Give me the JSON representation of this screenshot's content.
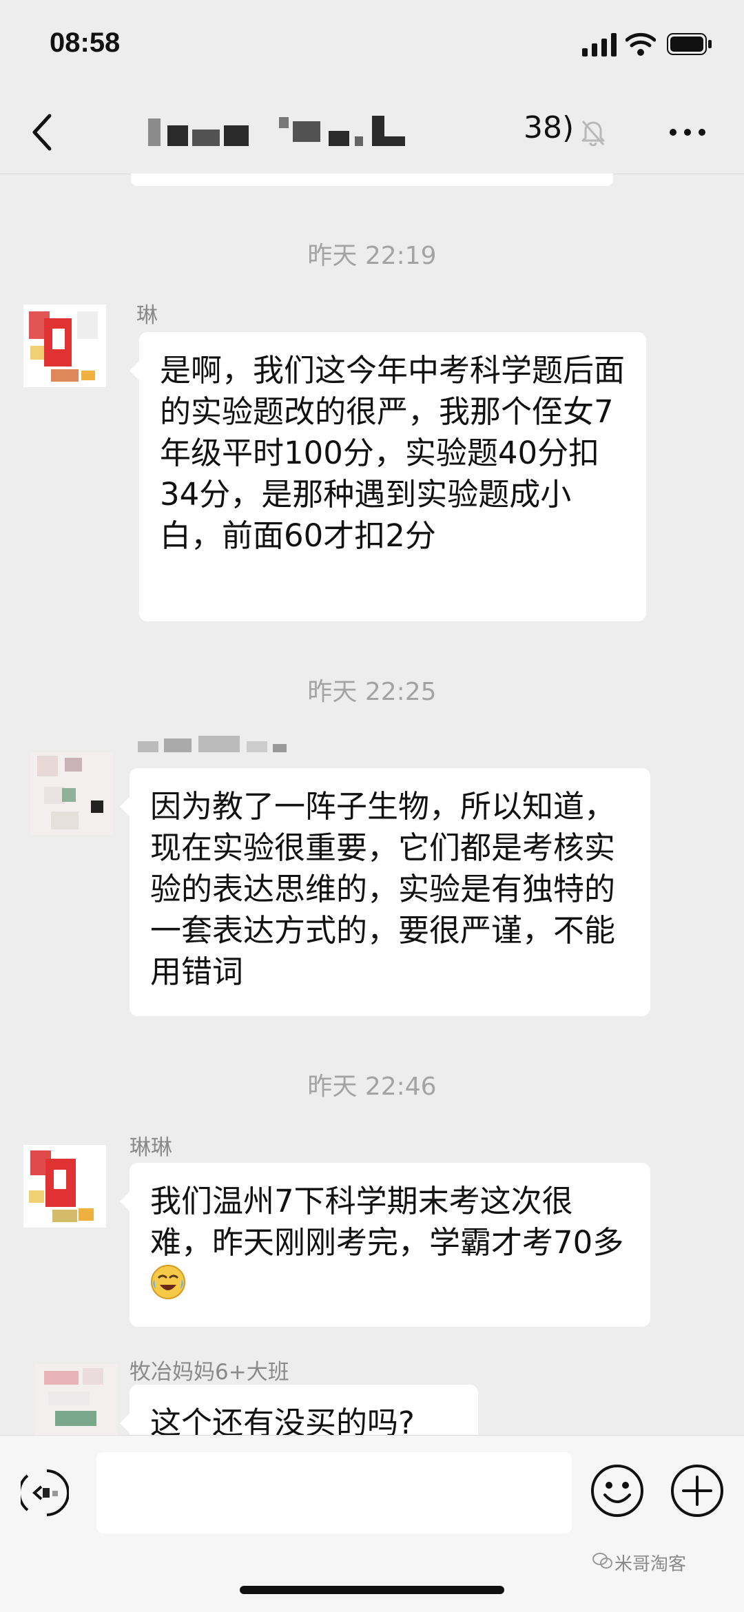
{
  "status_bar": {
    "time": "08:58"
  },
  "nav": {
    "title_visible": "38)"
  },
  "timestamps": [
    "昨天 22:19",
    "昨天 22:25",
    "昨天 22:46"
  ],
  "messages": [
    {
      "sender": "琳",
      "text": "是啊，我们这今年中考科学题后面的实验题改的很严，我那个侄女7年级平时100分，实验题40分扣34分，是那种遇到实验题成小白，前面60才扣2分"
    },
    {
      "sender": "",
      "text": "因为教了一阵子生物，所以知道，现在实验很重要，它们都是考核实验的表达思维的，实验是有独特的一套表达方式的，要很严谨，不能用错词"
    },
    {
      "sender": "琳琳",
      "text": "我们温州7下科学期末考这次很难，昨天刚刚考完，学霸才考70多",
      "emoji": "crying-laughing-emoji"
    },
    {
      "sender": "牧冶妈妈6+大班",
      "text": "这个还有没买的吗?"
    }
  ],
  "input_bar": {
    "placeholder": ""
  },
  "watermark": "米哥淘客",
  "icons": [
    "back-icon",
    "mute-icon",
    "more-icon",
    "voice-icon",
    "emoji-icon",
    "plus-icon",
    "wechat-icon"
  ]
}
